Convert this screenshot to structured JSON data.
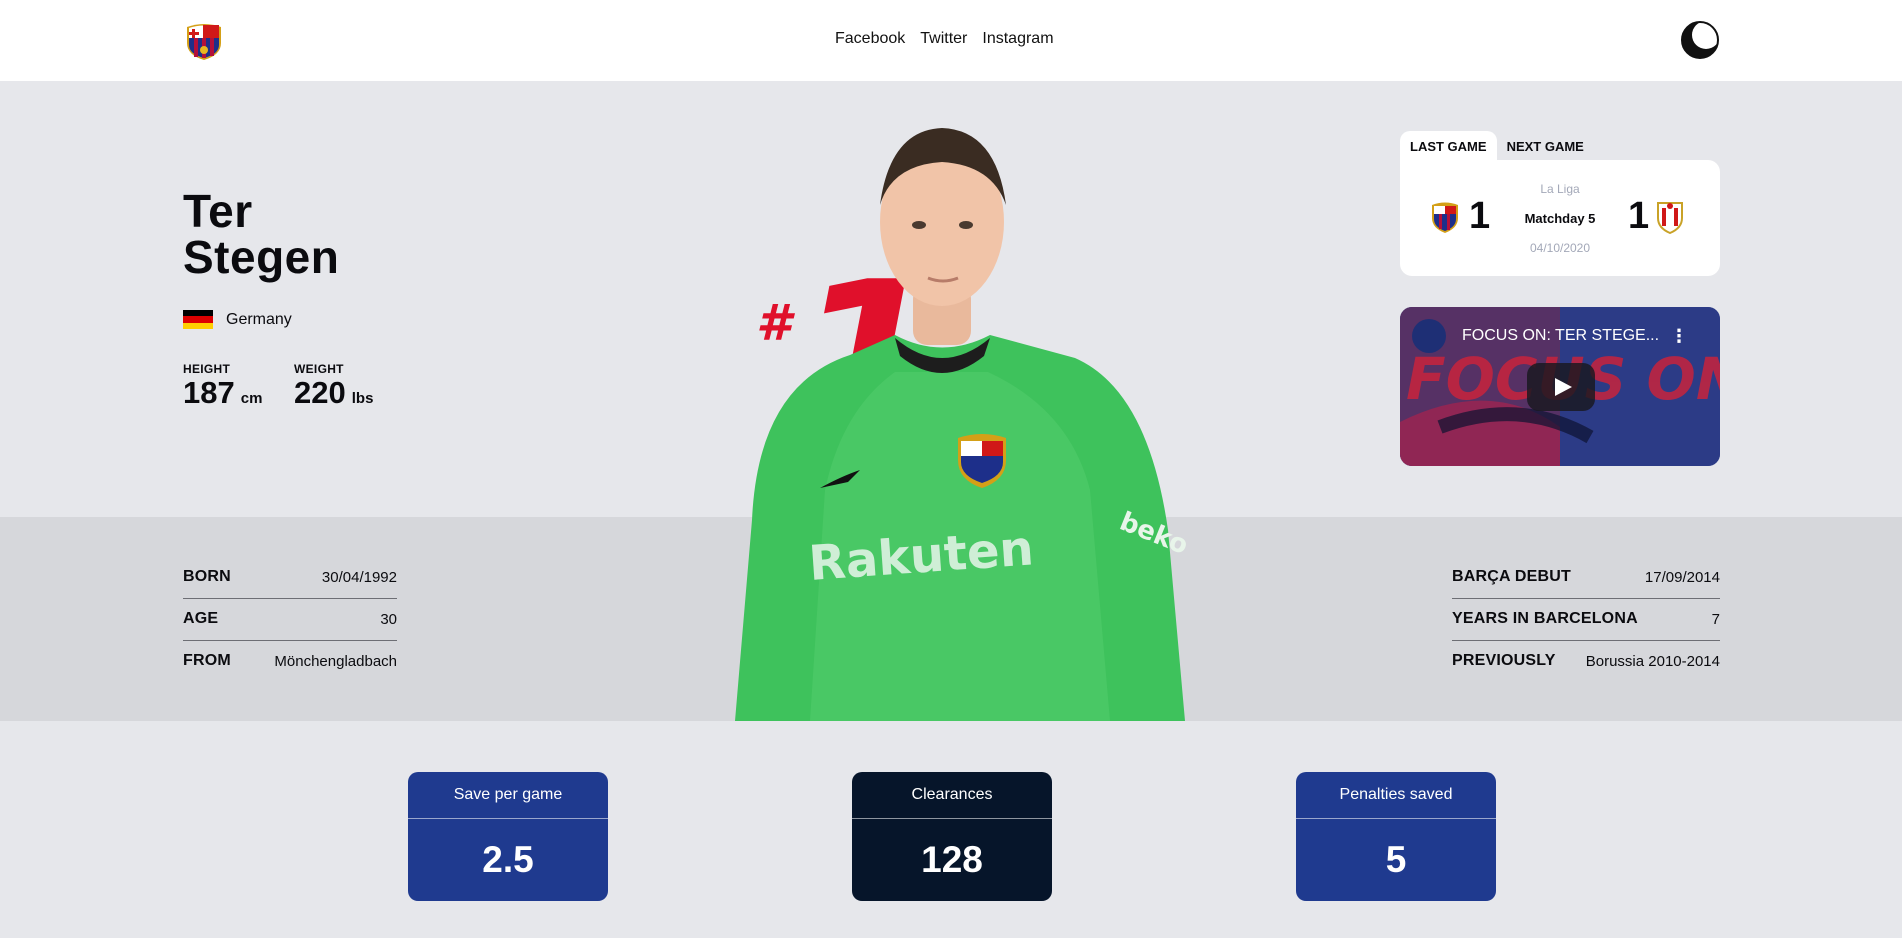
{
  "nav": {
    "links": [
      "Facebook",
      "Twitter",
      "Instagram"
    ]
  },
  "player": {
    "first_name": "Ter",
    "last_name": "Stegen",
    "country": "Germany",
    "number_hash": "#",
    "number": "1",
    "height_label": "HEIGHT",
    "height_value": "187",
    "height_unit": "cm",
    "weight_label": "WEIGHT",
    "weight_value": "220",
    "weight_unit": "lbs",
    "shirt_sponsor": "Rakuten",
    "sleeve_sponsor": "beko"
  },
  "match": {
    "tabs": [
      "LAST GAME",
      "NEXT GAME"
    ],
    "active_tab": 0,
    "home_score": "1",
    "away_score": "1",
    "competition": "La Liga",
    "matchday": "Matchday 5",
    "date": "04/10/2020"
  },
  "video": {
    "title": "FOCUS ON: TER STEGE...",
    "menu": "⋮",
    "overlay_text": "FOCUS ON"
  },
  "bio_left": [
    {
      "label": "BORN",
      "value": "30/04/1992"
    },
    {
      "label": "AGE",
      "value": "30"
    },
    {
      "label": "FROM",
      "value": "Mönchengladbach"
    }
  ],
  "bio_right": [
    {
      "label": "BARÇA DEBUT",
      "value": "17/09/2014"
    },
    {
      "label": "YEARS IN BARCELONA",
      "value": "7"
    },
    {
      "label": "PREVIOUSLY",
      "value": "Borussia 2010-2014"
    }
  ],
  "stats": [
    {
      "label": "Save per game",
      "value": "2.5",
      "color": "#1f3a8f"
    },
    {
      "label": "Clearances",
      "value": "128",
      "color": "#06152a"
    },
    {
      "label": "Penalties saved",
      "value": "5",
      "color": "#1f3a8f"
    }
  ],
  "colors": {
    "accent_red": "#e0102b",
    "barca_blue": "#1f3a8f",
    "navy": "#06152a",
    "jersey_green": "#3ec25c"
  }
}
